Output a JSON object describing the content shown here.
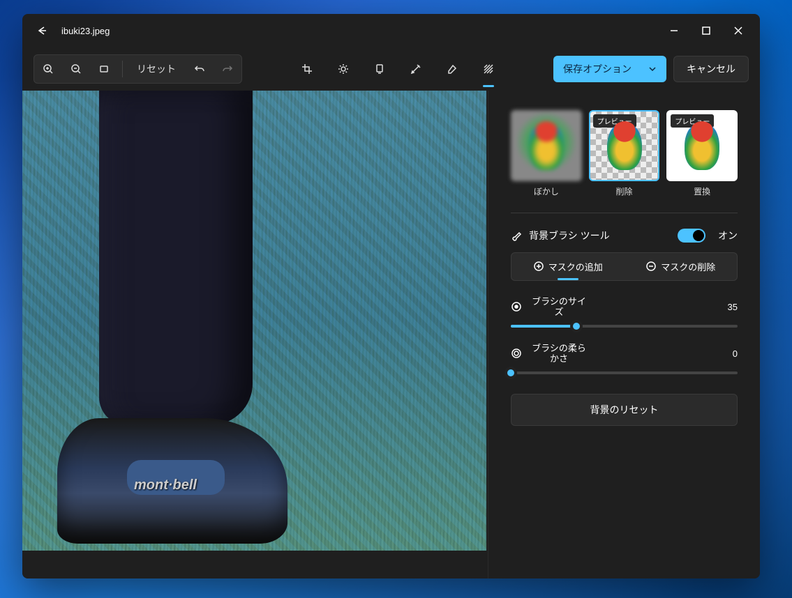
{
  "titlebar": {
    "filename": "ibuki23.jpeg"
  },
  "toolbar": {
    "reset": "リセット",
    "save_options": "保存オプション",
    "cancel": "キャンセル"
  },
  "image": {
    "brand_text": "mont·bell"
  },
  "bg_options": [
    {
      "label": "ぼかし",
      "preview": false
    },
    {
      "label": "削除",
      "preview": true,
      "selected": true
    },
    {
      "label": "置換",
      "preview": true
    }
  ],
  "preview_badge": "プレビュー",
  "brush_tool": {
    "title": "背景ブラシ ツール",
    "toggle_label": "オン",
    "add_mask": "マスクの追加",
    "remove_mask": "マスクの削除",
    "size_label": "ブラシのサイズ",
    "size_value": "35",
    "size_pct": 29,
    "soft_label": "ブラシの柔らかさ",
    "soft_value": "0",
    "soft_pct": 0,
    "reset_bg": "背景のリセット"
  }
}
